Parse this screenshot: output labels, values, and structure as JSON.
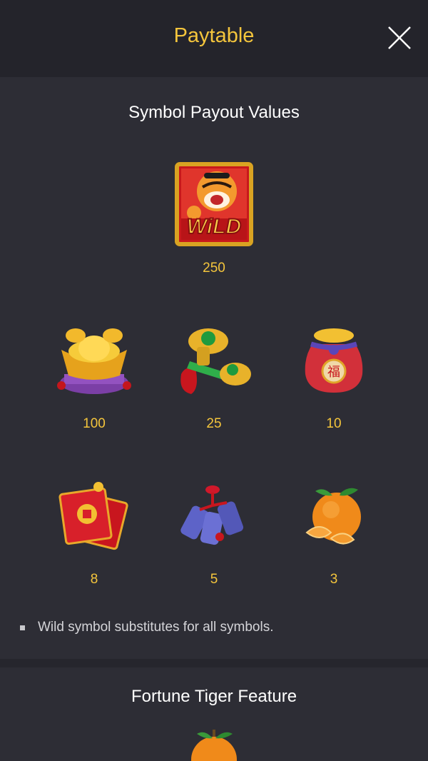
{
  "header": {
    "title": "Paytable",
    "close_icon": "close-icon"
  },
  "sections": {
    "payout_title": "Symbol Payout Values",
    "feature_title": "Fortune Tiger Feature"
  },
  "wild": {
    "icon": "wild-tiger-icon",
    "label": "WiLD",
    "value": "250"
  },
  "symbols": [
    {
      "icon": "gold-ingot-icon",
      "value": "100"
    },
    {
      "icon": "jade-pendant-icon",
      "value": "25"
    },
    {
      "icon": "fortune-bag-icon",
      "value": "10"
    },
    {
      "icon": "red-envelope-icon",
      "value": "8"
    },
    {
      "icon": "firecracker-icon",
      "value": "5"
    },
    {
      "icon": "orange-icon",
      "value": "3"
    }
  ],
  "rules": [
    "Wild symbol substitutes for all symbols."
  ],
  "colors": {
    "accent": "#f4c53c",
    "background": "#2d2d35",
    "header": "#24242b"
  }
}
